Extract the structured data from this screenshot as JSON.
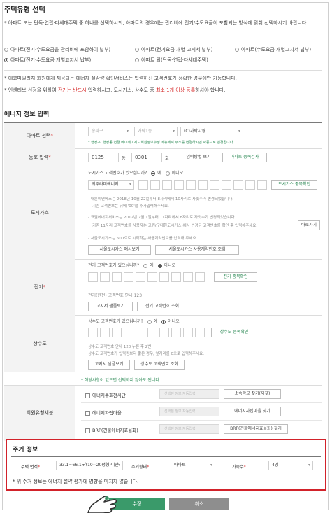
{
  "section1": {
    "title": "주택유형 선택",
    "desc_1": "* 아파트 또는 단독·연립·다세대주택 중 하나를 선택하시되, 아파트의 경우에는 관리비에 전기/수도요금이 포함되는 방식에 맞춰 선택하시기 바랍니다.",
    "options": [
      {
        "label": "아파트(전기·수도요금을 관리비에 포함하여 납부)",
        "selected": false
      },
      {
        "label": "아파트(전기요금 개별 고지서 납부)",
        "selected": false
      },
      {
        "label": "아파트(수도요금 개별고지서 납부)",
        "selected": false
      },
      {
        "label": "아파트(전기·수도요금 개별고지서 납부)",
        "selected": true
      },
      {
        "label": "아파트 외(단독·연립·다세대주택)",
        "selected": false
      }
    ],
    "note_1": "* 에코마일리지 회원에게 제공되는 에너지 절감량 확인서비스는 입력하신 고객번호가 정확한 경우에만 가능합니다.",
    "note_2_a": "* 인센티브 선정을 위하여 ",
    "note_2_red1": "전기는 반드시",
    "note_2_b": " 입력하시고, 도시가스, 상수도 중 ",
    "note_2_red2": "최소 1개 이상 등록",
    "note_2_c": "하셔야 합니다."
  },
  "section2": {
    "title": "에너지 정보 입력",
    "apt": {
      "label": "아파트 선택",
      "sel_1": "송파구",
      "sel_2": "가락1동",
      "sel_3": "(C)가락시영",
      "hint": "* 행정구, 행정동 변경 에이레이지 - 회원정보수정 메뉴에서 주소를 변경하시면 자동으로 변경됩니다."
    },
    "dong": {
      "label": "동호 입력",
      "dong_value": "0125",
      "dong_unit": "동",
      "ho_value": "0301",
      "ho_unit": "호",
      "btn_1": "입력방법 보기",
      "btn_2": "아파트 중복검사"
    },
    "gas": {
      "label": "도시가스",
      "question": "도시가스 고객번호가 있으십니까?",
      "yes": "예",
      "no": "아니오",
      "company": "귀뚜라미에너지",
      "dup_btn": "도시가스 중복확인",
      "info_1": "- 대륜이엔에스는 2018년 10월 22일부터 8자리에서 10자리로 자릿수가 변경되었습니다.",
      "info_1b": "기존 고객번호는 뒤에 '00'을 추가입력해주세요.",
      "info_2": "- 코원에너지서비스는 2012년 7월 1일부터 11자리에서 8자리로 자릿수가 변경되었습니다.",
      "info_2b": "기존 11자리 고객번호를 사용자는 코원(구대한도시가스)에서 변경된 고객번호를 확인 후 입력해주세요.",
      "shortcut_btn": "바로가기",
      "info_3": "- 서울도시가스는 600으로 시작하는 사용계약번호를 입력해 주세요.",
      "btn_example": "서울도시가스 예시보기",
      "btn_lookup": "서울도시가스 사용계약번호 조회"
    },
    "elec": {
      "label": "전기",
      "question": "전기 고객번호가 있으십니까?",
      "yes": "예",
      "no": "아니오",
      "dup_btn": "전기 중복확인",
      "info": "전기(한전) 고객번호 안내 123",
      "btn_1": "고지서 샘플보기",
      "btn_2": "전기 고객번호 조회"
    },
    "water": {
      "label": "상수도",
      "question": "상수도 고객번호가 있으십니까?",
      "yes": "예",
      "no": "아니오",
      "dup_btn": "상수도 중복확인",
      "info_1": "상수도 고객번호 안내 120 누른 후 2번",
      "info_2": "상수도 고객번호가 입력란보다 짧은 경우, 앞자리를 0으로 입력해주세요.",
      "btn_1": "고지서 샘플보기",
      "btn_2": "상수도 고객번호 조회"
    },
    "member": {
      "hint": "* 해당사항이 없으면 선택하지 않아도 됩니다.",
      "label": "회원유형세분",
      "row_1": "에너지수호천사단",
      "row_2": "에너지자립마을",
      "row_3": "BRP(건물에너지효율화)",
      "gray_ph": "선택된 정보 자동입력",
      "btn_1": "소속학교 찾기(재찾)",
      "btn_2": "에너지자립마을 찾기",
      "btn_3": "BRP(건물에너지효율화) 찾기"
    }
  },
  "residence": {
    "title": "주거 정보",
    "area_label": "주택 면적",
    "area_value": "33.1~66.1㎡(10~20평형)미만",
    "type_label": "주거형태",
    "type_value": "아파트",
    "family_label": "가족수",
    "family_value": "4명",
    "note": "* 위 주거 정보는 에너지 절약 평가에 영향을 미치지 않습니다."
  },
  "actions": {
    "edit": "수정",
    "cancel": "취소"
  },
  "colors": {
    "accent_red": "#d2222a",
    "green_button": "#3a9a6a",
    "gray_button": "#8e8e8e"
  }
}
